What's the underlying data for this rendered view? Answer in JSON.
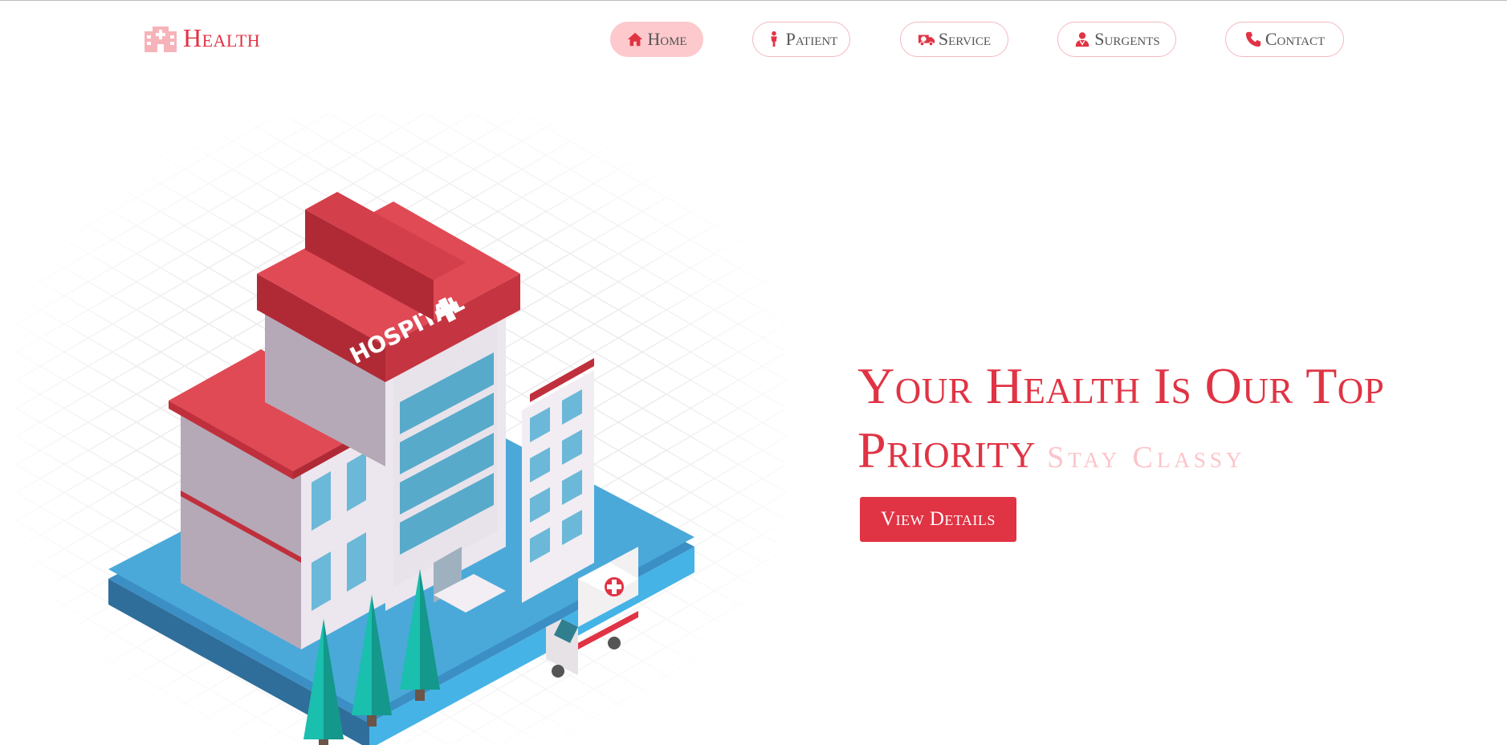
{
  "brand": {
    "name": "Health",
    "icon": "hospital-building-icon"
  },
  "nav": {
    "items": [
      {
        "label": "Home",
        "icon": "home-icon",
        "active": true
      },
      {
        "label": "Patient",
        "icon": "person-icon",
        "active": false
      },
      {
        "label": "Service",
        "icon": "ambulance-icon",
        "active": false
      },
      {
        "label": "Surgents",
        "icon": "doctor-icon",
        "active": false
      },
      {
        "label": "Contact",
        "icon": "phone-icon",
        "active": false
      }
    ]
  },
  "hero": {
    "headline": "Your Health Is Our Top Priority",
    "tagline": "Stay Classy",
    "cta_label": "View Details",
    "illustration": {
      "sign_text": "HOSPITAL",
      "description_icon": "hospital-illustration"
    }
  },
  "colors": {
    "accent": "#e03344",
    "accent_light": "#fdc9cd",
    "tagline": "#fbc4c9",
    "nav_text": "#555555",
    "ground": "#4aa9d9"
  }
}
